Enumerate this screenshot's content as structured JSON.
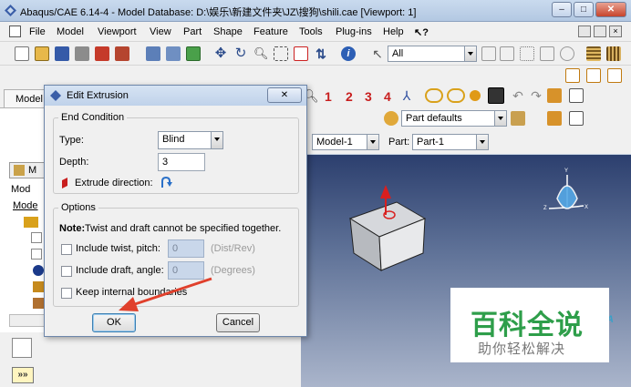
{
  "window": {
    "title": "Abaqus/CAE 6.14-4 - Model Database: D:\\娱乐\\新建文件夹\\JZ\\搜狗\\shili.cae [Viewport: 1]",
    "min_label": "–",
    "max_label": "□",
    "close_label": "✕"
  },
  "menubar": {
    "items": [
      "File",
      "Model",
      "Viewport",
      "View",
      "Part",
      "Shape",
      "Feature",
      "Tools",
      "Plug-ins",
      "Help",
      "↖?"
    ]
  },
  "toolbar": {
    "selection_filter": "All",
    "numbers": [
      "1",
      "2",
      "3",
      "4"
    ],
    "part_defaults": "Part defaults"
  },
  "context": {
    "model_tab_label": "Model",
    "model_label": "Model:",
    "model_value": "Model-1",
    "part_label": "Part:",
    "part_value": "Part-1"
  },
  "tree": {
    "items": [
      "Mod",
      "Mode"
    ],
    "combo": "M"
  },
  "dialog": {
    "title": "Edit Extrusion",
    "end_condition": {
      "group_label": "End Condition",
      "type_label": "Type:",
      "type_value": "Blind",
      "depth_label": "Depth:",
      "depth_value": "3",
      "extrude_direction_label": "Extrude direction:"
    },
    "options": {
      "group_label": "Options",
      "note_bold": "Note:",
      "note_text": " Twist and draft cannot be specified together.",
      "twist_label": "Include twist, pitch:",
      "twist_value": "0",
      "twist_unit": "(Dist/Rev)",
      "draft_label": "Include draft, angle:",
      "draft_value": "0",
      "draft_unit": "(Degrees)",
      "keep_label": "Keep internal boundaries"
    },
    "ok_label": "OK",
    "cancel_label": "Cancel"
  },
  "bottom": {
    "expand_label": "»»"
  },
  "watermark": {
    "main": "百科全说",
    "sub": "助你轻松解决"
  },
  "colors": {
    "accent_arrow": "#e0402c",
    "watermark_green": "#2e9e4a"
  }
}
